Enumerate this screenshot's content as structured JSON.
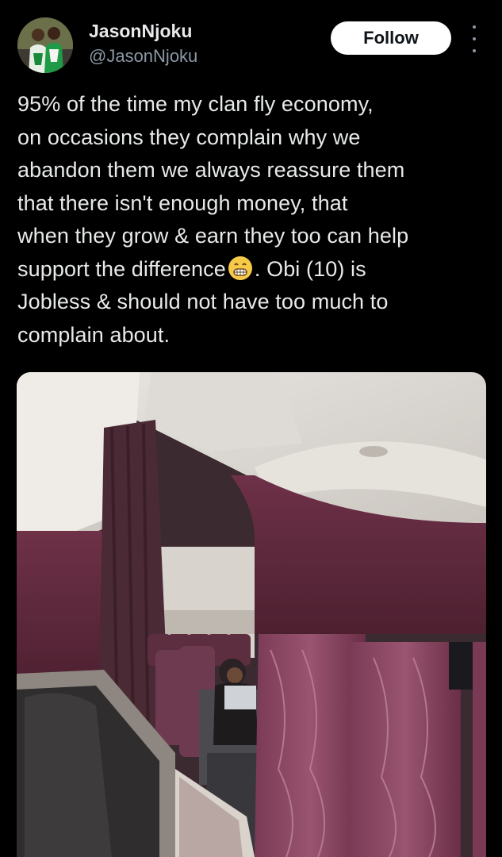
{
  "author": {
    "display_name": "JasonNjoku",
    "handle": "@JasonNjoku",
    "follow_label": "Follow",
    "avatar_icon": "user-avatar-photo",
    "more_icon": "more-vertical-icon"
  },
  "tweet": {
    "lines": [
      "95% of the time my clan fly economy,",
      "on occasions they complain why we",
      "abandon them we always reassure them",
      "that there isn't enough money, that",
      "when they grow & earn they too can help",
      "support the difference",
      ". Obi (10) is",
      "Jobless & should not have too much to",
      "complain about."
    ],
    "emoji": "grinning-face-emoji"
  },
  "media": {
    "kind": "photo",
    "description_icon": "airplane-cabin-photo"
  },
  "colors": {
    "background": "#000000",
    "text": "#e7e9ea",
    "secondary_text": "#8b98a5",
    "follow_bg": "#ffffff"
  }
}
